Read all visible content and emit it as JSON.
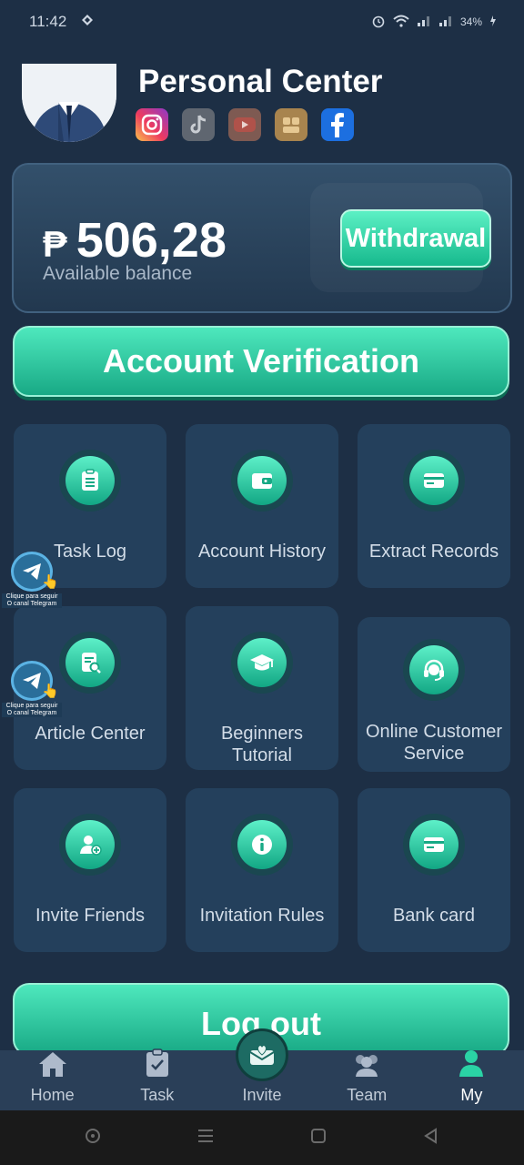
{
  "status_bar": {
    "time": "11:42",
    "battery": "34%"
  },
  "header": {
    "title": "Personal Center",
    "socials": [
      "instagram",
      "tiktok",
      "youtube",
      "kwai",
      "facebook"
    ]
  },
  "balance": {
    "currency": "₱",
    "amount": "506,28",
    "label": "Available balance",
    "withdraw_label": "Withdrawal"
  },
  "verify_label": "Account Verification",
  "grid": [
    {
      "label": "Task Log",
      "icon": "list-icon"
    },
    {
      "label": "Account History",
      "icon": "wallet-icon"
    },
    {
      "label": "Extract Records",
      "icon": "card-icon"
    },
    {
      "label": "Article Center",
      "icon": "document-search-icon"
    },
    {
      "label": "Beginners Tutorial",
      "icon": "graduation-cap-icon"
    },
    {
      "label": "Online Customer Service",
      "icon": "headset-icon"
    },
    {
      "label": "Invite Friends",
      "icon": "add-user-icon"
    },
    {
      "label": "Invitation Rules",
      "icon": "info-icon"
    },
    {
      "label": "Bank card",
      "icon": "bank-card-icon"
    }
  ],
  "telegram_badge": {
    "caption_line1": "Clique para seguir",
    "caption_line2": "O canal Telegram"
  },
  "logout_label": "Log out",
  "nav": [
    {
      "label": "Home",
      "icon": "home-icon"
    },
    {
      "label": "Task",
      "icon": "clipboard-icon"
    },
    {
      "label": "Invite",
      "icon": "envelope-heart-icon"
    },
    {
      "label": "Team",
      "icon": "team-icon"
    },
    {
      "label": "My",
      "icon": "user-icon"
    }
  ],
  "colors": {
    "background": "#1d2f45",
    "accent": "#2ad3a5",
    "tile": "#24405c"
  }
}
